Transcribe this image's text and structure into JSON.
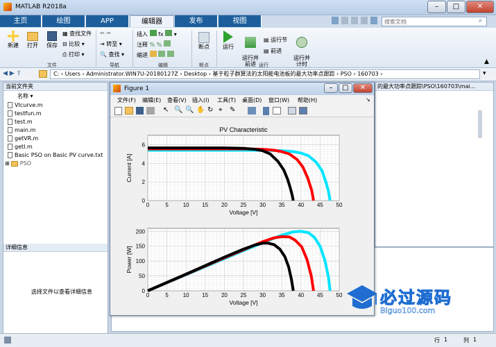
{
  "window": {
    "title": "MATLAB R2018a"
  },
  "tabs": [
    {
      "label": "主页"
    },
    {
      "label": "绘图"
    },
    {
      "label": "APP"
    },
    {
      "label": "编辑器"
    },
    {
      "label": "发布"
    },
    {
      "label": "视图"
    }
  ],
  "search": {
    "placeholder": "搜索文档"
  },
  "toolstrip": {
    "new": "新建",
    "open": "打开",
    "save": "保存",
    "find_files": "查找文件",
    "compare": "比较",
    "print": "打印",
    "goto": "转至",
    "find": "查找",
    "insert": "插入",
    "comment": "注释",
    "indent": "缩进",
    "breakpoints": "断点",
    "run": "运行",
    "run_advance": "运行并\n前进",
    "run_section": "运行节",
    "advance": "前进",
    "run_time": "运行并\n计时",
    "groups": {
      "file": "文件",
      "navigate": "导航",
      "edit": "编辑",
      "breakpoints": "断点",
      "run": "运行"
    }
  },
  "address": {
    "path": "C: › Users › Administrator.WIN7U-20180127Z › Desktop › 基于粒子群算法的太阳能电池板的最大功率点跟踪 › PSO › 160703 ›"
  },
  "current_folder": {
    "header": "当前文件夹",
    "column": "名称",
    "files": [
      "VIcurve.m",
      "testfun.m",
      "test.m",
      "main.m",
      "getVR.m",
      "getI.m",
      "Basic PSO on Basic PV curve.txt"
    ],
    "folder": "PSO"
  },
  "details": {
    "header": "详细信息",
    "hint": "选择文件以查看详细信息"
  },
  "right_panel": {
    "path_fragment": "的最大功率点跟踪\\PSO\\160703\\mai..."
  },
  "figure": {
    "title": "Figure 1",
    "menu": [
      "文件(F)",
      "编辑(E)",
      "查看(V)",
      "插入(I)",
      "工具(T)",
      "桌面(D)",
      "窗口(W)",
      "帮助(H)"
    ]
  },
  "status": {
    "row_label": "行",
    "row": "1",
    "col_label": "列",
    "col": "1"
  },
  "watermark": {
    "text": "必过源码",
    "sub": "Biguo100.com"
  },
  "chart_data": [
    {
      "type": "line",
      "title": "PV Characteristic",
      "xlabel": "Voltage [V]",
      "ylabel": "Current [A]",
      "xlim": [
        0,
        50
      ],
      "ylim": [
        0,
        7
      ],
      "xticks": [
        0,
        5,
        10,
        15,
        20,
        25,
        30,
        35,
        40,
        45,
        50
      ],
      "yticks": [
        0,
        2,
        4,
        6
      ],
      "grid": true,
      "series": [
        {
          "color": "#00e5ff",
          "x": [
            0,
            10,
            20,
            30,
            35,
            38,
            40,
            42,
            44,
            45.5,
            46.5,
            47.2,
            47.6
          ],
          "y": [
            5.4,
            5.4,
            5.4,
            5.4,
            5.35,
            5.25,
            5.1,
            4.8,
            4.1,
            3.2,
            2.0,
            1.0,
            0
          ]
        },
        {
          "color": "#ff0000",
          "x": [
            0,
            10,
            20,
            25,
            30,
            33,
            35,
            37,
            39,
            40.5,
            41.8,
            42.8,
            43.3
          ],
          "y": [
            5.55,
            5.55,
            5.55,
            5.55,
            5.5,
            5.4,
            5.25,
            5.0,
            4.4,
            3.6,
            2.4,
            1.1,
            0
          ]
        },
        {
          "color": "#000000",
          "x": [
            0,
            10,
            20,
            25,
            28,
            30,
            32,
            34,
            35.5,
            36.5,
            37.2,
            37.7,
            38
          ],
          "y": [
            5.65,
            5.65,
            5.65,
            5.6,
            5.5,
            5.35,
            5.0,
            4.2,
            3.3,
            2.3,
            1.4,
            0.6,
            0
          ]
        }
      ]
    },
    {
      "type": "line",
      "xlabel": "Voltage [V]",
      "ylabel": "Power [W]",
      "xlim": [
        0,
        50
      ],
      "ylim": [
        0,
        210
      ],
      "xticks": [
        0,
        5,
        10,
        15,
        20,
        25,
        30,
        35,
        40,
        45,
        50
      ],
      "yticks": [
        0,
        50,
        100,
        150,
        200
      ],
      "grid": true,
      "series": [
        {
          "color": "#00e5ff",
          "x": [
            0,
            10,
            20,
            30,
            35,
            38,
            40,
            42,
            43.5,
            45,
            46.3,
            47.2,
            47.6
          ],
          "y": [
            0,
            54,
            108,
            162,
            187,
            198,
            200,
            195,
            180,
            150,
            100,
            45,
            0
          ]
        },
        {
          "color": "#ff0000",
          "x": [
            0,
            10,
            20,
            25,
            30,
            33,
            35,
            37,
            38.5,
            40.2,
            41.6,
            42.7,
            43.3
          ],
          "y": [
            0,
            55,
            111,
            138,
            165,
            178,
            182,
            181,
            170,
            148,
            105,
            50,
            0
          ]
        },
        {
          "color": "#000000",
          "x": [
            0,
            10,
            20,
            25,
            28,
            30,
            31.5,
            33,
            34.5,
            35.8,
            36.8,
            37.5,
            38
          ],
          "y": [
            0,
            56,
            113,
            140,
            154,
            160,
            160,
            155,
            140,
            115,
            80,
            40,
            0
          ]
        }
      ]
    }
  ]
}
